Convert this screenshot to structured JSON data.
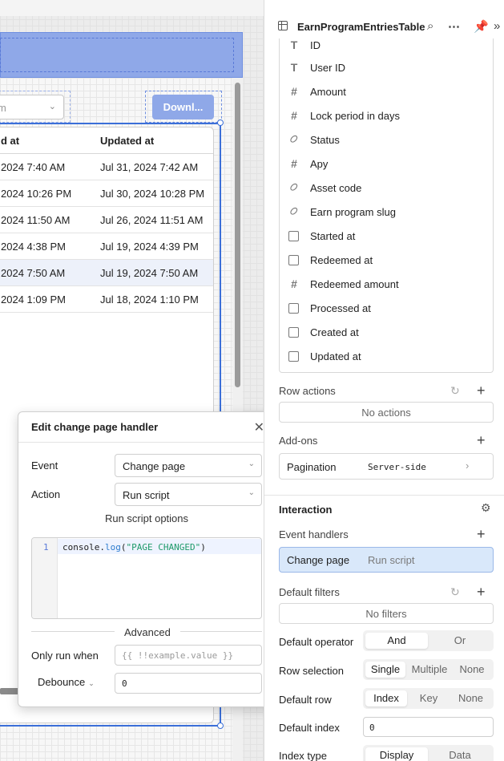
{
  "table": {
    "columns": [
      "d at",
      "Updated at"
    ],
    "rows": [
      [
        "2024 7:40 AM",
        "Jul 31, 2024 7:42 AM"
      ],
      [
        "2024 10:26 PM",
        "Jul 30, 2024 10:28 PM"
      ],
      [
        "2024 11:50 AM",
        "Jul 26, 2024 11:51 AM"
      ],
      [
        "2024 4:38 PM",
        "Jul 19, 2024 4:39 PM"
      ],
      [
        "2024 7:50 AM",
        "Jul 19, 2024 7:50 AM"
      ],
      [
        "2024 1:09 PM",
        "Jul 18, 2024 1:10 PM"
      ]
    ],
    "select_placeholder": "m",
    "download_label": "Downl..."
  },
  "modal": {
    "title": "Edit change page handler",
    "event_label": "Event",
    "event_value": "Change page",
    "action_label": "Action",
    "action_value": "Run script",
    "options_heading": "Run script options",
    "code_line_number": "1",
    "code": {
      "obj": "console",
      "dot": ".",
      "method": "log",
      "open": "(",
      "str": "\"PAGE CHANGED\"",
      "close": ")"
    },
    "advanced_heading": "Advanced",
    "only_run_label": "Only run when",
    "only_run_placeholder": "{{ !!example.value }}",
    "debounce_label": "Debounce",
    "debounce_value": "0"
  },
  "panel": {
    "title": "EarnProgramEntriesTable",
    "columns": [
      {
        "label": "ID",
        "icon": "text-icon"
      },
      {
        "label": "User ID",
        "icon": "text-icon"
      },
      {
        "label": "Amount",
        "icon": "hash-icon"
      },
      {
        "label": "Lock period in days",
        "icon": "hash-icon"
      },
      {
        "label": "Status",
        "icon": "tag-icon"
      },
      {
        "label": "Apy",
        "icon": "hash-icon"
      },
      {
        "label": "Asset code",
        "icon": "tag-icon"
      },
      {
        "label": "Earn program slug",
        "icon": "tag-icon"
      },
      {
        "label": "Started at",
        "icon": "calendar-icon"
      },
      {
        "label": "Redeemed at",
        "icon": "calendar-icon"
      },
      {
        "label": "Redeemed amount",
        "icon": "hash-icon"
      },
      {
        "label": "Processed at",
        "icon": "calendar-icon"
      },
      {
        "label": "Created at",
        "icon": "calendar-icon"
      },
      {
        "label": "Updated at",
        "icon": "calendar-icon"
      }
    ],
    "row_actions": {
      "title": "Row actions",
      "empty": "No actions"
    },
    "addons": {
      "title": "Add-ons",
      "name": "Pagination",
      "value": "Server-side"
    },
    "interaction": {
      "title": "Interaction"
    },
    "event_handlers": {
      "title": "Event handlers",
      "event": "Change page",
      "action": "Run script"
    },
    "default_filters": {
      "title": "Default filters",
      "empty": "No filters"
    },
    "default_operator": {
      "label": "Default operator",
      "options": [
        "And",
        "Or"
      ],
      "selected": "And"
    },
    "row_selection": {
      "label": "Row selection",
      "options": [
        "Single",
        "Multiple",
        "None"
      ],
      "selected": "Single"
    },
    "default_row": {
      "label": "Default row",
      "options": [
        "Index",
        "Key",
        "None"
      ],
      "selected": "Index"
    },
    "default_index": {
      "label": "Default index",
      "value": "0"
    },
    "index_type": {
      "label": "Index type",
      "options": [
        "Display",
        "Data"
      ],
      "selected": "Display"
    }
  },
  "colors": {
    "accent": "#3b6fd8",
    "header_band": "#8fa8e8",
    "handler_highlight": "#d9e8fa"
  }
}
